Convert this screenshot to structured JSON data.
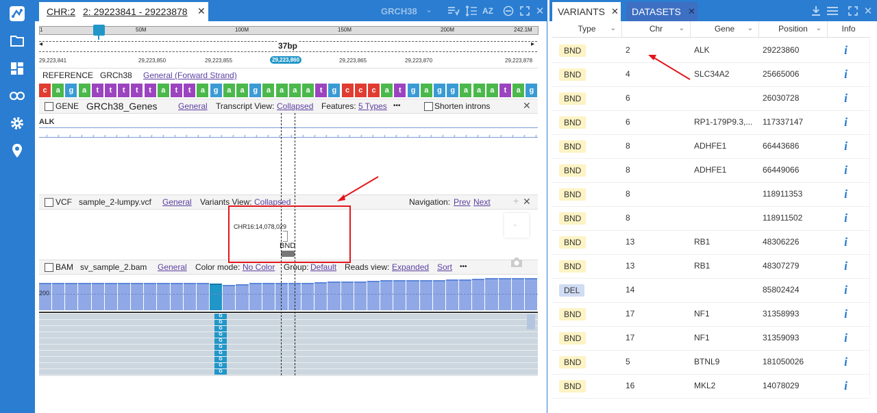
{
  "main_tab": {
    "chr": "CHR:2",
    "range": "2: 29223841 - 29223878",
    "genome": "GRCH38"
  },
  "ruler": {
    "ticks": [
      "1",
      "50M",
      "100M",
      "150M",
      "200M",
      "242.1M"
    ],
    "span": "37bp",
    "positions": [
      "29,223,841",
      "29,223,850",
      "29,223,855",
      "29,223,860",
      "29,223,865",
      "29,223,870",
      "29,223,878"
    ]
  },
  "reference": {
    "label": "REFERENCE",
    "genome": "GRCh38",
    "strand": "General (Forward Strand)",
    "sequence": "cagatttttattagaagaaaatgcccatgaggaaatag",
    "colors": {
      "a": "#4bb84b",
      "c": "#e03c31",
      "g": "#3a9bd4",
      "t": "#9c44c0"
    }
  },
  "gene_track": {
    "type": "GENE",
    "name": "GRCh38_Genes",
    "general": "General",
    "transcript_label": "Transcript View:",
    "transcript_value": "Collapsed",
    "features_label": "Features:",
    "features_value": "5 Types",
    "more": "•••",
    "shorten": "Shorten introns",
    "gene": "ALK"
  },
  "vcf_track": {
    "type": "VCF",
    "name": "sample_2-lumpy.vcf",
    "general": "General",
    "variants_label": "Variants View:",
    "variants_value": "Collapsed",
    "nav_label": "Navigation:",
    "prev": "Prev",
    "next": "Next",
    "breakend": "CHR16:14,078,029",
    "variant_type": "BND"
  },
  "bam_track": {
    "type": "BAM",
    "name": "sv_sample_2.bam",
    "general": "General",
    "color_label": "Color mode:",
    "color_value": "No Color",
    "group_label": "Group:",
    "group_value": "Default",
    "reads_label": "Reads view:",
    "reads_value": "Expanded",
    "sort": "Sort",
    "more": "•••",
    "cov_scale": "200",
    "base": "G"
  },
  "right_tabs": {
    "variants": "VARIANTS",
    "datasets": "DATASETS"
  },
  "table": {
    "headers": [
      "Type",
      "Chr",
      "Gene",
      "Position",
      "Info"
    ],
    "rows": [
      {
        "type": "BND",
        "chr": "2",
        "gene": "ALK",
        "position": "29223860"
      },
      {
        "type": "BND",
        "chr": "4",
        "gene": "SLC34A2",
        "position": "25665006"
      },
      {
        "type": "BND",
        "chr": "6",
        "gene": "",
        "position": "26030728"
      },
      {
        "type": "BND",
        "chr": "6",
        "gene": "RP1-179P9.3,...",
        "position": "117337147"
      },
      {
        "type": "BND",
        "chr": "8",
        "gene": "ADHFE1",
        "position": "66443686"
      },
      {
        "type": "BND",
        "chr": "8",
        "gene": "ADHFE1",
        "position": "66449066"
      },
      {
        "type": "BND",
        "chr": "8",
        "gene": "",
        "position": "118911353"
      },
      {
        "type": "BND",
        "chr": "8",
        "gene": "",
        "position": "118911502"
      },
      {
        "type": "BND",
        "chr": "13",
        "gene": "RB1",
        "position": "48306226"
      },
      {
        "type": "BND",
        "chr": "13",
        "gene": "RB1",
        "position": "48307279"
      },
      {
        "type": "DEL",
        "chr": "14",
        "gene": "",
        "position": "85802424"
      },
      {
        "type": "BND",
        "chr": "17",
        "gene": "NF1",
        "position": "31358993"
      },
      {
        "type": "BND",
        "chr": "17",
        "gene": "NF1",
        "position": "31359093"
      },
      {
        "type": "BND",
        "chr": "5",
        "gene": "BTNL9",
        "position": "181050026"
      },
      {
        "type": "BND",
        "chr": "16",
        "gene": "MKL2",
        "position": "14078029"
      }
    ],
    "info_glyph": "i",
    "badge_colors": {
      "BND": "#fdf3c4",
      "DEL": "#cfdcf3"
    }
  },
  "colors": {
    "brand": "#2a7dd1",
    "annotation": "#e3161b",
    "highlight": "#2196c8"
  }
}
